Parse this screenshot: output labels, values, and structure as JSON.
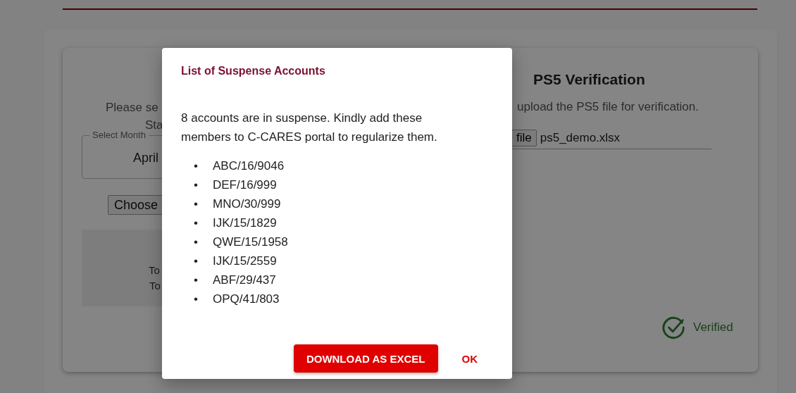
{
  "page": {
    "left_panel": {
      "instruction_lines": [
        "Please se",
        "Sta"
      ],
      "month_field": {
        "label": "Select Month",
        "value": "April"
      },
      "choose_button": "Choose",
      "summary_lines": [
        "To",
        "To"
      ]
    },
    "right_panel": {
      "title": "PS5 Verification",
      "instruction": "upload the PS5 file for verification.",
      "file_button": "file",
      "file_name": "ps5_demo.xlsx",
      "status": {
        "label": "Verified",
        "verified": true
      }
    }
  },
  "dialog": {
    "title": "List of Suspense Accounts",
    "message": "8 accounts are in suspense. Kindly add these members to C-CARES portal to regularize them.",
    "bullet": "•",
    "accounts": [
      "ABC/16/9046",
      "DEF/16/999",
      "MNO/30/999",
      "IJK/15/1829",
      "QWE/15/1958",
      "IJK/15/2559",
      "ABF/29/437",
      "OPQ/41/803"
    ],
    "buttons": [
      {
        "label": "DOWNLOAD AS EXCEL",
        "kind": "primary"
      },
      {
        "label": "OK",
        "kind": "text"
      }
    ]
  }
}
